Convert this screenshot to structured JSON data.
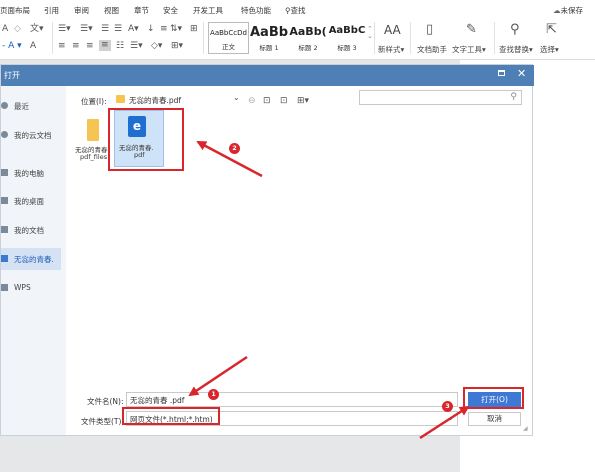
{
  "menu": [
    "页面布局",
    "引用",
    "审阅",
    "视图",
    "章节",
    "安全",
    "开发工具",
    "特色功能"
  ],
  "search_label": "查找",
  "unsaved_label": "未保存",
  "ribbon": {
    "styles": [
      {
        "sample": "AaBbCcDd",
        "label": "正文"
      },
      {
        "sample": "AaBb",
        "label": "标题 1"
      },
      {
        "sample": "AaBb(",
        "label": "标题 2"
      },
      {
        "sample": "AaBbC",
        "label": "标题 3"
      }
    ],
    "new_style": "新样式",
    "doc_assistant": "文档助手",
    "text_tools": "文字工具",
    "find_replace": "查找替换",
    "select": "选择"
  },
  "dialog": {
    "title": "打开",
    "sidebar": [
      "最近",
      "我的云文档",
      "我的电脑",
      "我的桌面",
      "我的文档",
      "无惢的青春.",
      "WPS"
    ],
    "location_label": "位置(I):",
    "location_value": "无惢的青春.pdf",
    "files": [
      {
        "name_line1": "无惢的青春.",
        "name_line2": "pdf_files"
      },
      {
        "name_line1": "无惢的青春.",
        "name_line2": "pdf"
      }
    ],
    "filename_label": "文件名(N):",
    "filename_value": "无惢的青春 .pdf",
    "filetype_label": "文件类型(T):",
    "filetype_value": "网页文件(*.html;*.htm)",
    "open_button": "打开(O)",
    "cancel_button": "取消",
    "badges": [
      "1",
      "2",
      "3"
    ]
  },
  "colors": {
    "accent": "#4e7fb5",
    "annotation": "#d8262c",
    "open_button": "#3d78d4"
  }
}
